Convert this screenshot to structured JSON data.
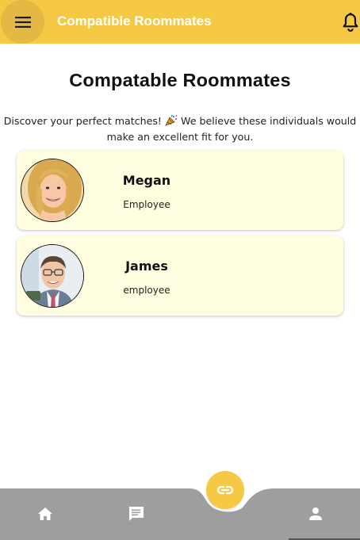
{
  "app_bar": {
    "title": "Compatible Roommates",
    "menu_icon": "menu-icon",
    "notification_icon": "bell-icon"
  },
  "main": {
    "heading": "Compatable Roommates",
    "intro_line_1": "Discover your perfect matches!",
    "intro_emoji": "party-popper-emoji",
    "intro_line_1b": "We believe these individuals would",
    "intro_line_2": "make an excellent fit for you."
  },
  "roommates": [
    {
      "name": "Megan",
      "role": "Employee",
      "avatar": "woman-photo"
    },
    {
      "name": "James",
      "role": "employee",
      "avatar": "man-photo"
    }
  ],
  "bottom_nav": {
    "items": [
      {
        "icon": "home-icon"
      },
      {
        "icon": "chat-icon"
      },
      {
        "icon": "link-icon"
      },
      {
        "icon": "person-icon"
      }
    ]
  },
  "colors": {
    "accent": "#f6c945",
    "card_background": "#fffee1",
    "nav_background": "#9e9e9e"
  }
}
